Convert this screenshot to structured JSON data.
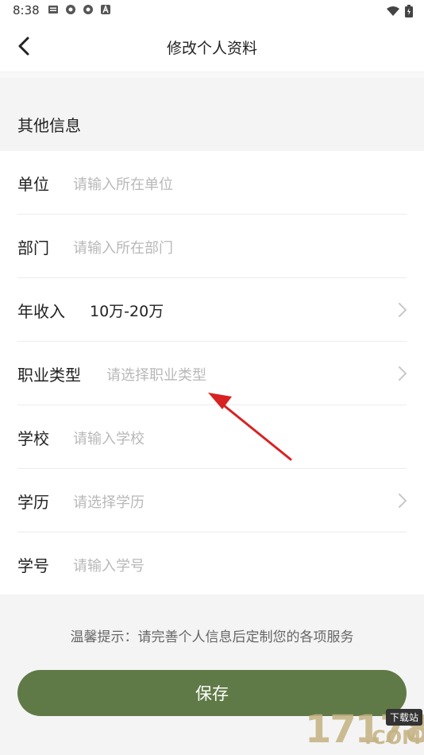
{
  "status_bar": {
    "time": "8:38",
    "left_icons": [
      "mail-icon",
      "ring-app-icon",
      "ring-app-icon",
      "a-app-icon"
    ],
    "right_icons": [
      "wifi-icon",
      "battery-icon"
    ]
  },
  "nav": {
    "title": "修改个人资料"
  },
  "section": {
    "title": "其他信息"
  },
  "form": {
    "rows": [
      {
        "label": "单位",
        "placeholder": "请输入所在单位",
        "value": ""
      },
      {
        "label": "部门",
        "placeholder": "请输入所在部门",
        "value": ""
      },
      {
        "label": "年收入",
        "placeholder": "",
        "value": "10万-20万"
      },
      {
        "label": "职业类型",
        "placeholder": "请选择职业类型",
        "value": ""
      },
      {
        "label": "学校",
        "placeholder": "请输入学校",
        "value": ""
      },
      {
        "label": "学历",
        "placeholder": "请选择学历",
        "value": ""
      },
      {
        "label": "学号",
        "placeholder": "请输入学号",
        "value": ""
      }
    ]
  },
  "tip": "温馨提示：请完善个人信息后定制您的各项服务",
  "save_label": "保存",
  "watermark": {
    "digits": "17178",
    "badge": "下载站",
    "suffix": ".COM"
  },
  "colors": {
    "primary": "#607a47",
    "placeholder": "#b8b8b8",
    "annotation_arrow": "#e02020"
  }
}
